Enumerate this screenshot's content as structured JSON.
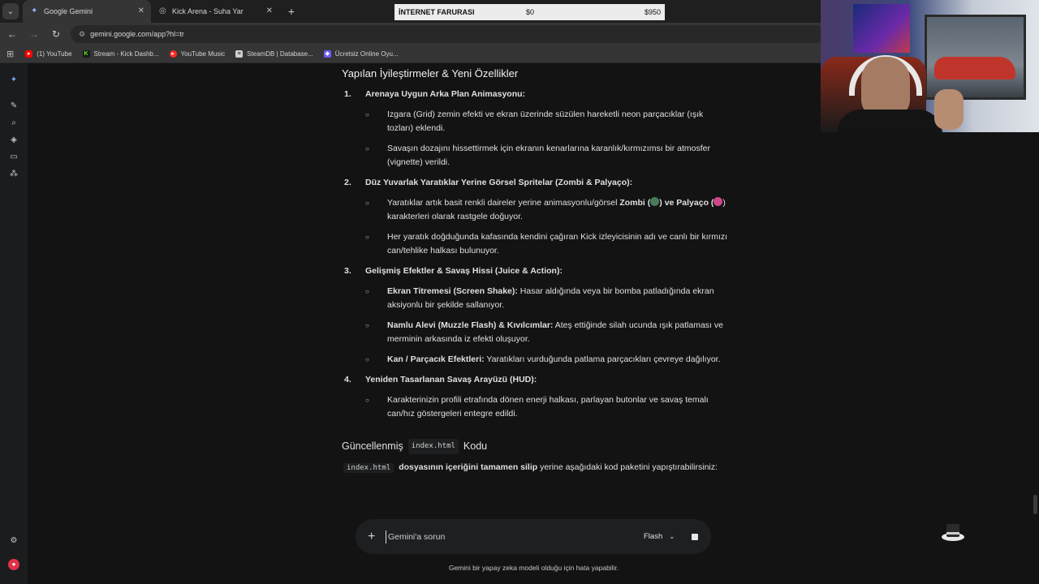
{
  "browser": {
    "tabs": [
      {
        "label": "Google Gemini",
        "active": true,
        "icon": "gemini-star-icon"
      },
      {
        "label": "Kick Arena - Suha Yar",
        "active": false,
        "icon": "globe-icon"
      }
    ],
    "url": "gemini.google.com/app?hl=tr",
    "bookmarks": [
      {
        "label": "(1) YouTube",
        "icon": "youtube-icon",
        "color": "#ff0000"
      },
      {
        "label": "Stream - Kick Dashb...",
        "icon": "kick-icon",
        "color": "#53fc18"
      },
      {
        "label": "YouTube Music",
        "icon": "youtube-music-icon",
        "color": "#ff2a2a"
      },
      {
        "label": "SteamDB | Database...",
        "icon": "steamdb-icon",
        "color": "#cfcfcf"
      },
      {
        "label": "Ücretsiz Online Oyu...",
        "icon": "game-icon",
        "color": "#6a5cff"
      }
    ]
  },
  "overlay": {
    "title": "İNTERNET FARURASI",
    "start": "$0",
    "end": "$950",
    "progress": 0.0
  },
  "content": {
    "heading": "Yapılan İyileştirmeler & Yeni Özellikler",
    "items": [
      {
        "num": "1.",
        "title": "Arenaya Uygun Arka Plan Animasyonu:",
        "bullets": [
          {
            "bold": "",
            "text": "Izgara (Grid) zemin efekti ve ekran üzerinde süzülen hareketli neon parçacıklar (ışık tozları) eklendi."
          },
          {
            "bold": "",
            "text": "Savaşın dozajını hissettirmek için ekranın kenarlarına karanlık/kırmızımsı bir atmosfer (vignette) verildi."
          }
        ]
      },
      {
        "num": "2.",
        "title": "Düz Yuvarlak Yaratıklar Yerine Görsel Spritelar (Zombi & Palyaço):",
        "bullets": [
          {
            "pre": "Yaratıklar artık basit renkli daireler yerine animasyonlu/görsel ",
            "b1": "Zombi (",
            "e1": "#4a7a5a",
            "mid": ") ve ",
            "b2": "Palyaço",
            "b2b": "(",
            "e2": "#d0468a",
            "post": ") karakterleri olarak rastgele doğuyor."
          },
          {
            "bold": "",
            "text": "Her yaratık doğduğunda kafasında kendini çağıran Kick izleyicisinin adı ve canlı bir kırmızı can/tehlike halkası bulunuyor."
          }
        ]
      },
      {
        "num": "3.",
        "title": "Gelişmiş Efektler & Savaş Hissi (Juice & Action):",
        "bullets": [
          {
            "bold": "Ekran Titremesi (Screen Shake):",
            "text": " Hasar aldığında veya bir bomba patladığında ekran aksiyonlu bir şekilde sallanıyor."
          },
          {
            "bold": "Namlu Alevi (Muzzle Flash) & Kıvılcımlar:",
            "text": " Ateş ettiğinde silah ucunda ışık patlaması ve merminin arkasında iz efekti oluşuyor."
          },
          {
            "bold": "Kan / Parçacık Efektleri:",
            "text": " Yaratıkları vurduğunda patlama parçacıkları çevreye dağılıyor."
          }
        ]
      },
      {
        "num": "4.",
        "title": "Yeniden Tasarlanan Savaş Arayüzü (HUD):",
        "bullets": [
          {
            "bold": "",
            "text": "Karakterinizin profili etrafında dönen enerji halkası, parlayan butonlar ve savaş temalı can/hız göstergeleri entegre edildi."
          }
        ]
      }
    ],
    "updated": {
      "pre": "Güncellenmiş",
      "code": "index.html",
      "post": "Kodu"
    },
    "instruction": {
      "code": "index.html",
      "t1": "dosyasının ",
      "b1": "içeriğini tamamen silip",
      "t2": " yerine aşağıdaki kod paketini yapıştırabilirsiniz:"
    }
  },
  "prompt": {
    "placeholder": "Gemini'a sorun",
    "model": "Flash"
  },
  "disclaimer": "Gemini bir yapay zeka modeli olduğu için hata yapabilir."
}
